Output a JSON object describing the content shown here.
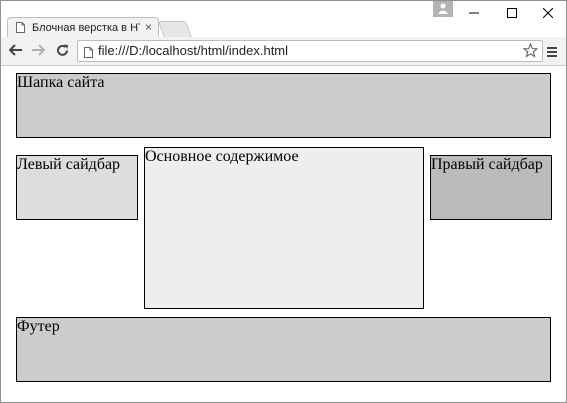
{
  "browser": {
    "tab_title": "Блочная верстка в HTML",
    "tab_close": "×",
    "url": "file:///D:/localhost/html/index.html",
    "icons": [
      "page-icon",
      "profile-icon",
      "minimize-icon",
      "maximize-icon",
      "close-icon",
      "back-icon",
      "forward-icon",
      "reload-icon",
      "bookmark-star-icon",
      "menu-icon"
    ]
  },
  "page": {
    "header": "Шапка сайта",
    "left_sidebar": "Левый сайдбар",
    "main": "Основное содержимое",
    "right_sidebar": "Правый сайдбар",
    "footer": "Футер"
  },
  "colors": {
    "header_bg": "#cccccc",
    "left_bg": "#dddddd",
    "main_bg": "#eeeeee",
    "right_bg": "#bbbbbb",
    "footer_bg": "#cccccc"
  }
}
